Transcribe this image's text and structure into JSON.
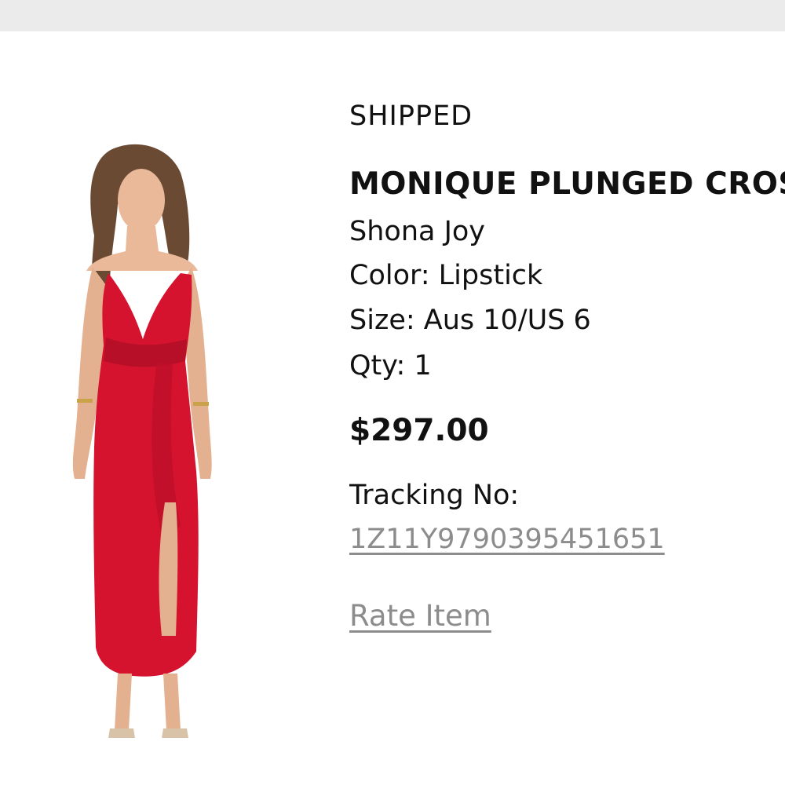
{
  "order_item": {
    "status": "SHIPPED",
    "title": "MONIQUE PLUNGED CROSS FRONT DRESS",
    "brand": "Shona Joy",
    "color_line": "Color: Lipstick",
    "size_line": "Size: Aus 10/US 6",
    "qty_line": "Qty: 1",
    "price": "$297.00",
    "tracking_label": "Tracking No:",
    "tracking_number": "1Z11Y9790395451651",
    "rate_item_label": "Rate Item",
    "dress_color": "#d5132f",
    "link_color": "#8c8c8c"
  }
}
